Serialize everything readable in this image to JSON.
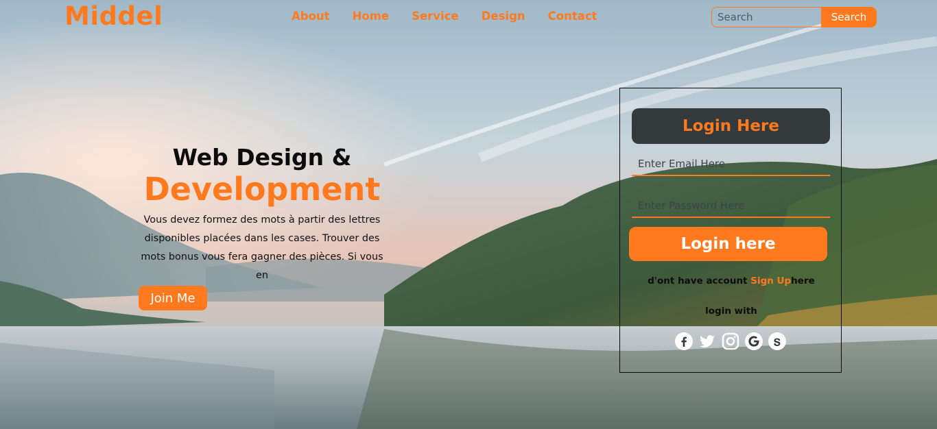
{
  "header": {
    "logo": "Middel",
    "nav": [
      "About",
      "Home",
      "Service",
      "Design",
      "Contact"
    ],
    "search": {
      "placeholder": "Search",
      "button_label": "Search"
    }
  },
  "hero": {
    "title_line1": "Web Design &",
    "title_line2": "Development",
    "text": "Vous devez formez des mots à partir des lettres disponibles placées dans les cases. Trouver des mots bonus vous fera gagner des pièces. Si vous en",
    "button_label": "Join Me"
  },
  "login": {
    "heading": "Login Here",
    "email_placeholder": "Enter Email Here",
    "password_placeholder": "Enter Password Here",
    "button_label": "Login here",
    "no_account_prefix": "d'ont have account",
    "signup_link": "Sign Up",
    "no_account_suffix": "here",
    "login_with": "login with",
    "social_icons": [
      "facebook-icon",
      "twitter-icon",
      "instagram-icon",
      "google-icon",
      "skype-icon"
    ]
  },
  "colors": {
    "accent": "#ff7a1f",
    "login_header_bg": "#343a3c",
    "text_dark": "#0c0c0c"
  }
}
